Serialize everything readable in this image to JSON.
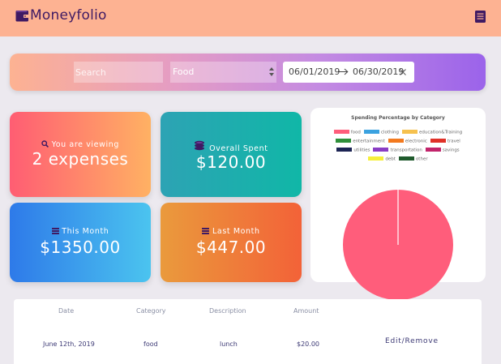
{
  "app": {
    "name": "Moneyfolio"
  },
  "colors": {
    "header": "#fdb292",
    "accent": "#3f1a63"
  },
  "icons": {
    "brand": "wallet-icon",
    "menu": "list-icon",
    "viewing": "search-icon",
    "spent": "coins-icon",
    "month": "money-stack-icon",
    "last_month": "money-stack-icon"
  },
  "filters": {
    "search_placeholder": "Search",
    "category_selected": "Food",
    "date_start": "06/01/2019",
    "date_end": "06/30/2019"
  },
  "cards": {
    "viewing": {
      "label": "You are viewing",
      "value": "2 expenses"
    },
    "overall": {
      "label": "Overall Spent",
      "value": "$120.00"
    },
    "this_month": {
      "label": "This Month",
      "value": "$1350.00"
    },
    "last_month": {
      "label": "Last Month",
      "value": "$447.00"
    }
  },
  "chart_data": {
    "type": "pie",
    "title": "Spending Percentage by Category",
    "categories": [
      "food",
      "clothing",
      "education&Training",
      "entertainment",
      "electronic",
      "travel",
      "utilities",
      "transportation",
      "savings",
      "debt",
      "other"
    ],
    "colors": [
      "#ff5d7b",
      "#3ba2e0",
      "#f6c14e",
      "#2f8f3a",
      "#f37a1f",
      "#e03128",
      "#1c2454",
      "#8a3dc4",
      "#c2246b",
      "#f6ef3a",
      "#1f5a2c"
    ],
    "values": [
      100,
      0,
      0,
      0,
      0,
      0,
      0,
      0,
      0,
      0,
      0
    ],
    "legend_position": "top"
  },
  "table": {
    "headers": [
      "Date",
      "Category",
      "Description",
      "Amount"
    ],
    "rows": [
      {
        "date": "June 12th, 2019",
        "category": "food",
        "description": "lunch",
        "amount": "$20.00",
        "action": "Edit/Remove"
      }
    ]
  }
}
